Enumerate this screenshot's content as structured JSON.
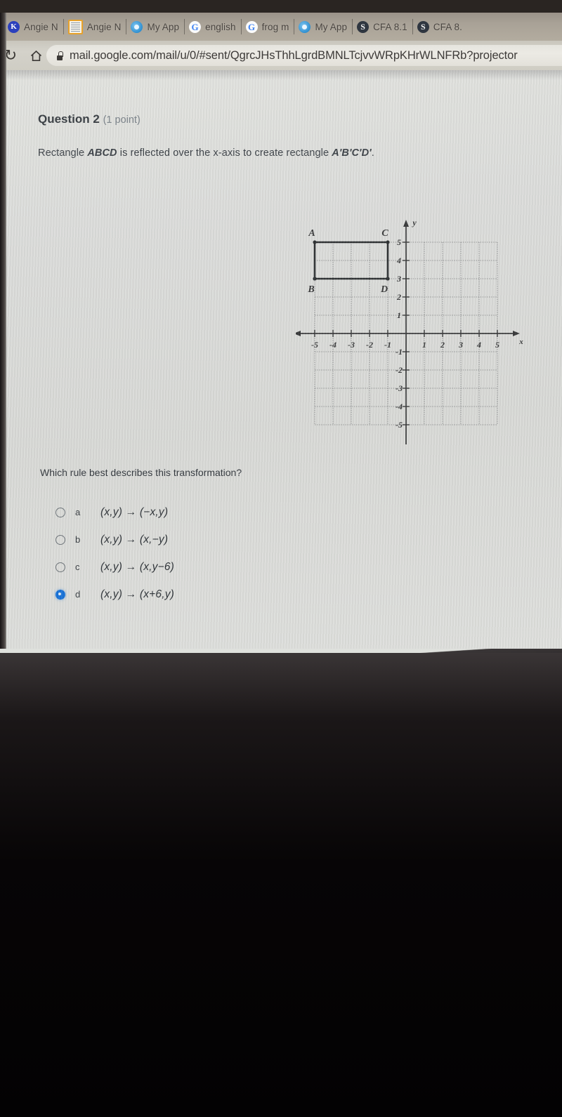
{
  "browser": {
    "bookmarks": [
      {
        "label": "Angie N",
        "icon": "kahoot-icon",
        "icon_kind": "k"
      },
      {
        "label": "Angie N",
        "icon": "document-icon",
        "icon_kind": "doc"
      },
      {
        "label": "My App",
        "icon": "edgenuity-icon",
        "icon_kind": "blue"
      },
      {
        "label": "english",
        "icon": "google-icon",
        "icon_kind": "g"
      },
      {
        "label": "frog m",
        "icon": "google-icon",
        "icon_kind": "g"
      },
      {
        "label": "My App",
        "icon": "edgenuity-icon",
        "icon_kind": "blue"
      },
      {
        "label": "CFA 8.1",
        "icon": "schoology-icon",
        "icon_kind": "s"
      },
      {
        "label": "CFA 8.",
        "icon": "schoology-icon",
        "icon_kind": "s"
      }
    ],
    "reload_glyph": "↻",
    "home_glyph": "⌂",
    "lock_icon": "lock-icon",
    "url": "mail.google.com/mail/u/0/#sent/QgrcJHsThhLgrdBMNLTcjvvWRpKHrWLNFRb?projector"
  },
  "question": {
    "number_label": "Question 2",
    "points_label": "(1 point)",
    "stem_before": "Rectangle ",
    "stem_shape": "ABCD",
    "stem_middle": " is reflected over the x-axis to create rectangle ",
    "stem_image": "A'B'C'D'",
    "stem_after": ".",
    "prompt": "Which rule best describes this transformation?"
  },
  "options": [
    {
      "key": "a",
      "rule": "(x,y) → (−x,y)",
      "selected": false
    },
    {
      "key": "b",
      "rule": "(x,y) → (x,−y)",
      "selected": false
    },
    {
      "key": "c",
      "rule": "(x,y) → (x,y−6)",
      "selected": false
    },
    {
      "key": "d",
      "rule": "(x,y) → (x+6,y)",
      "selected": true
    }
  ],
  "chart_data": {
    "type": "scatter",
    "title": "",
    "xlabel": "x",
    "ylabel": "y",
    "xlim": [
      -5,
      5
    ],
    "ylim": [
      -5,
      5
    ],
    "xticks": [
      -5,
      -4,
      -3,
      -2,
      -1,
      1,
      2,
      3,
      4,
      5
    ],
    "yticks": [
      5,
      4,
      3,
      2,
      1,
      -1,
      -2,
      -3,
      -4,
      -5
    ],
    "grid": true,
    "axis_arrow_labels": {
      "x": "x",
      "y": "y"
    },
    "shapes": [
      {
        "name": "rectangle ABCD",
        "vertices": [
          {
            "label": "A",
            "x": -5,
            "y": 5
          },
          {
            "label": "C",
            "x": -1,
            "y": 5
          },
          {
            "label": "D",
            "x": -1,
            "y": 3
          },
          {
            "label": "B",
            "x": -5,
            "y": 3
          }
        ],
        "label_positions": {
          "A": "top-left",
          "B": "bottom-left",
          "C": "top-right",
          "D": "bottom-right"
        }
      }
    ]
  }
}
